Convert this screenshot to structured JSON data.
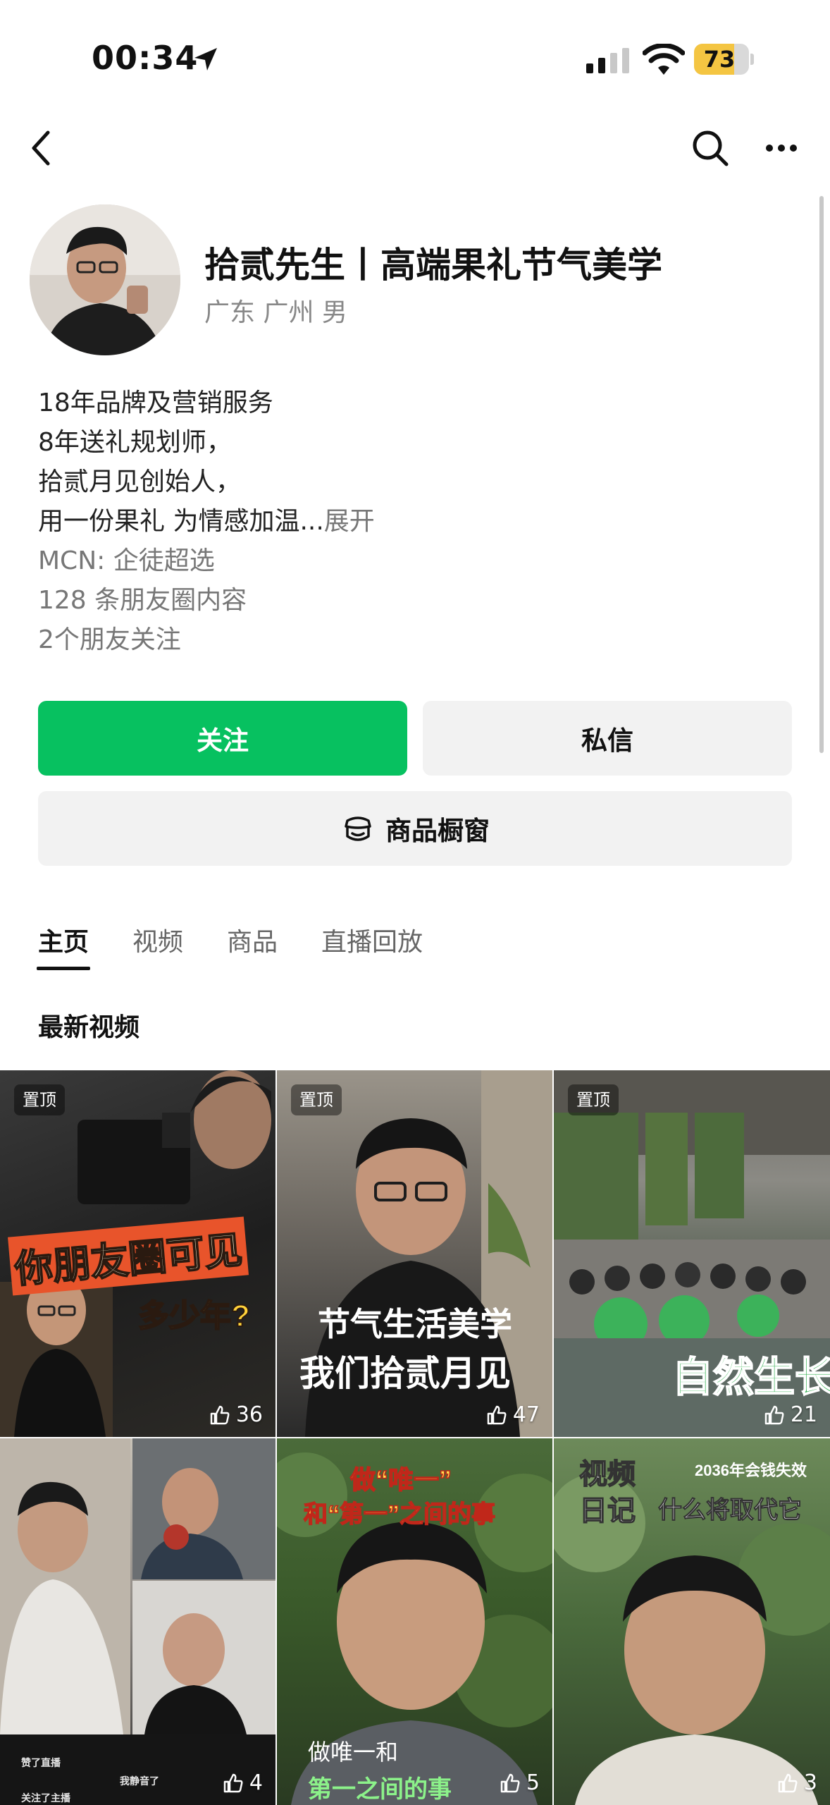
{
  "status_bar": {
    "time": "00:34",
    "battery": "73",
    "battery_level": 0.73
  },
  "nav": {
    "back_icon": "chevron-left-icon",
    "search_icon": "search-icon",
    "more_icon": "more-horizontal-icon"
  },
  "profile": {
    "name": "拾贰先生丨高端果礼节气美学",
    "location": "广东 广州 男",
    "bio_lines": [
      "18年品牌及营销服务",
      "8年送礼规划师，",
      "拾贰月见创始人，",
      "用一份果礼 为情感加温..."
    ],
    "expand_label": "展开",
    "mcn": "MCN: 企徒超选",
    "moments_count": "128 条朋友圈内容",
    "friends_following": "2个朋友关注"
  },
  "actions": {
    "follow_label": "关注",
    "message_label": "私信",
    "shop_label": "商品橱窗"
  },
  "tabs": [
    {
      "label": "主页",
      "active": true
    },
    {
      "label": "视频",
      "active": false
    },
    {
      "label": "商品",
      "active": false
    },
    {
      "label": "直播回放",
      "active": false
    }
  ],
  "section_title": "最新视频",
  "videos": [
    {
      "pinned_label": "置顶",
      "likes": "36",
      "caption": [
        "你朋友圈可见",
        "多少年?"
      ]
    },
    {
      "pinned_label": "置顶",
      "likes": "47",
      "caption": [
        "节气生活美学",
        "我们拾贰月见"
      ]
    },
    {
      "pinned_label": "置顶",
      "likes": "21",
      "caption": [
        "自然生长"
      ]
    },
    {
      "pinned_label": "",
      "likes": "4",
      "caption": [
        "赞了直播",
        "我静音了",
        "关注了主播"
      ]
    },
    {
      "pinned_label": "",
      "likes": "5",
      "caption": [
        "做“唯一”",
        "和“第一”之间的事",
        "做唯一和",
        "第一之间的事"
      ]
    },
    {
      "pinned_label": "",
      "likes": "3",
      "caption": [
        "视频",
        "日记",
        "2036年会钱失效",
        "什么将取代它"
      ]
    }
  ],
  "colors": {
    "accent_green": "#07c160",
    "secondary_button": "#f2f2f2",
    "battery_yellow": "#f4c542"
  }
}
